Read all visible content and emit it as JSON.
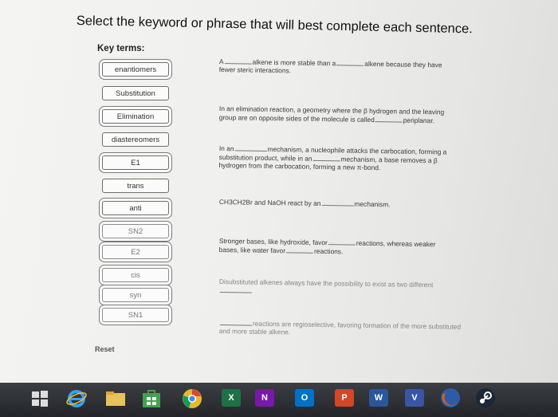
{
  "heading": "Select the keyword or phrase that will best complete each sentence.",
  "key_terms_label": "Key terms:",
  "terms": [
    "enantiomers",
    "Substitution",
    "Elimination",
    "diastereomers",
    "E1",
    "trans",
    "anti",
    "SN2",
    "E2",
    "cis",
    "syn",
    "SN1"
  ],
  "sentences": {
    "s1": {
      "p1": "A",
      "p2": "alkene is more stable than a",
      "p3": "alkene because they have",
      "p4": "fewer steric interactions."
    },
    "s2": {
      "p1": "In an elimination reaction, a geometry where the β hydrogen and the leaving",
      "p2": "group are on opposite sides of the molecule is called",
      "p3": "periplanar."
    },
    "s3": {
      "p1": "In an",
      "p2": "mechanism, a nucleophile attacks the carbocation, forming a",
      "p3": "substitution product, while in an",
      "p4": "mechanism, a base removes a β",
      "p5": "hydrogen from the carbocation, forming a new π-bond."
    },
    "s4": {
      "p1": "CH3CH2Br and NaOH react by an",
      "p2": "mechanism."
    },
    "s5": {
      "p1": "Stronger bases, like hydroxide, favor",
      "p2": "reactions, whereas weaker",
      "p3": "bases, like water favor",
      "p4": "reactions."
    },
    "s6": {
      "p1": "Disubstituted alkenes always have the possibility to exist as two different"
    },
    "s7": {
      "p1": "reactions are regioselective, favoring formation of the more substituted",
      "p2": "and more stable alkene."
    }
  },
  "reset_label": "Reset",
  "taskbar": {
    "excel": "X",
    "onenote": "N",
    "outlook": "O",
    "powerpoint": "P",
    "word": "W",
    "visio": "V"
  },
  "colors": {
    "excel": "#1e7145",
    "onenote": "#7719aa",
    "outlook": "#0072c6",
    "powerpoint": "#d24726",
    "word": "#2b579a",
    "visio": "#3955a3",
    "store": "#3fa34d",
    "chrome": "#e8b92f",
    "firefox": "#e66000"
  }
}
